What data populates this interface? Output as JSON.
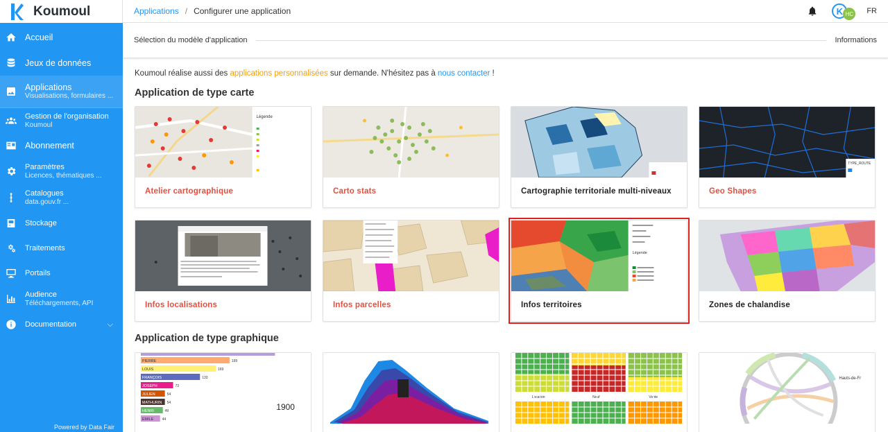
{
  "app": {
    "name": "Koumoul",
    "powered": "Powered by Data Fair"
  },
  "topbar": {
    "breadcrumb_root": "Applications",
    "breadcrumb_current": "Configurer une application",
    "avatar_letter": "K",
    "avatar_badge": "HC",
    "lang": "FR"
  },
  "sidebar": {
    "items": [
      {
        "label": "Accueil",
        "sub": "",
        "icon": "home-icon"
      },
      {
        "label": "Jeux de données",
        "sub": "",
        "icon": "database-icon"
      },
      {
        "label": "Applications",
        "sub": "Visualisations, formulaires ...",
        "icon": "image-icon"
      },
      {
        "label": "Gestion de l'organisation",
        "sub": "Koumoul",
        "icon": "group-icon"
      },
      {
        "label": "Abonnement",
        "sub": "",
        "icon": "card-icon"
      },
      {
        "label": "Paramètres",
        "sub": "Licences, thématiques ...",
        "icon": "gear-icon"
      },
      {
        "label": "Catalogues",
        "sub": "data.gouv.fr ...",
        "icon": "dots-icon"
      },
      {
        "label": "Stockage",
        "sub": "",
        "icon": "storage-icon"
      },
      {
        "label": "Traitements",
        "sub": "",
        "icon": "cogs-icon"
      },
      {
        "label": "Portails",
        "sub": "",
        "icon": "monitor-icon"
      },
      {
        "label": "Audience",
        "sub": "Téléchargements, API",
        "icon": "chart-icon"
      },
      {
        "label": "Documentation",
        "sub": "",
        "icon": "info-icon"
      }
    ]
  },
  "stepper": {
    "step1": "Sélection du modèle d'application",
    "step2": "Informations"
  },
  "intro": {
    "before": "Koumoul réalise aussi des ",
    "link1": "applications personnalisées",
    "middle": " sur demande. N'hésitez pas à ",
    "link2": "nous contacter",
    "after": " !"
  },
  "sections": {
    "map_title": "Application de type carte",
    "chart_title": "Application de type graphique"
  },
  "map_apps": [
    {
      "title": "Atelier cartographique",
      "style": "red"
    },
    {
      "title": "Carto stats",
      "style": "red"
    },
    {
      "title": "Cartographie territoriale multi-niveaux",
      "style": "dark"
    },
    {
      "title": "Geo Shapes",
      "style": "red"
    },
    {
      "title": "Infos localisations",
      "style": "red"
    },
    {
      "title": "Infos parcelles",
      "style": "red"
    },
    {
      "title": "Infos territoires",
      "style": "dark",
      "selected": true
    },
    {
      "title": "Zones de chalandise",
      "style": "dark"
    }
  ],
  "thumb_text": {
    "legend": "Légende",
    "type_route": "TYPE_ROUTE",
    "barchart_year": "1900",
    "bar_names": [
      "PIERRE",
      "LOUIS",
      "FRANÇOIS",
      "JOSEPH",
      "JULIEN",
      "MATHURIN",
      "HENRI",
      "EMILE"
    ],
    "bar_values": [
      "199",
      "169",
      "133",
      "73",
      "54",
      "54",
      "49",
      "44"
    ],
    "heat_labels": [
      "Location",
      "Neuf",
      "Vente"
    ],
    "chord_label": "Hauts-de-Fr"
  },
  "colors": {
    "accent": "#2196f3",
    "link_orange": "#f59e0b",
    "card_red": "#e74c3c",
    "selection": "#e02020"
  }
}
